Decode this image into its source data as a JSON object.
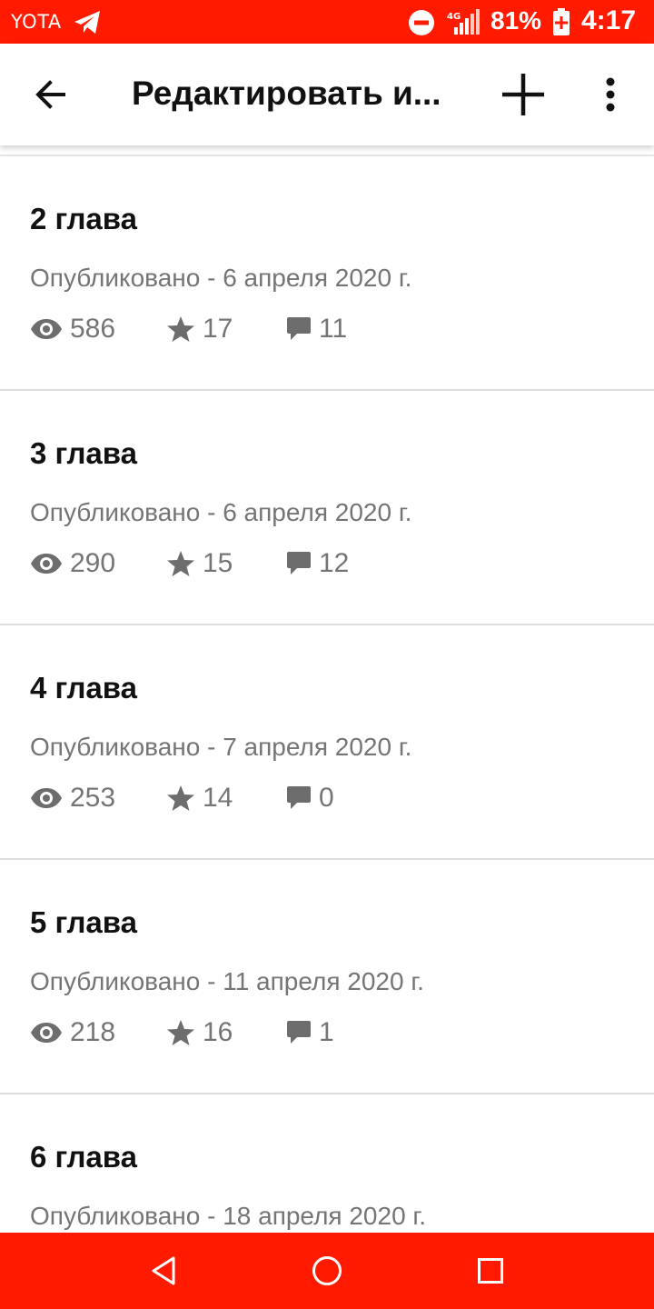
{
  "status_bar": {
    "carrier": "YOTA",
    "network": "4G",
    "battery": "81%",
    "time": "4:17",
    "icons": [
      "telegram-icon",
      "do-not-disturb-icon",
      "signal-icon",
      "battery-charging-icon"
    ]
  },
  "app_bar": {
    "title": "Редактировать и...",
    "icons": [
      "arrow-back-icon",
      "plus-icon",
      "more-vert-icon"
    ]
  },
  "chapters": [
    {
      "title": "2 глава",
      "published": "Опубликовано - 6 апреля 2020 г.",
      "views": "586",
      "votes": "17",
      "comments": "11"
    },
    {
      "title": "3 глава",
      "published": "Опубликовано - 6 апреля 2020 г.",
      "views": "290",
      "votes": "15",
      "comments": "12"
    },
    {
      "title": "4 глава",
      "published": "Опубликовано - 7 апреля 2020 г.",
      "views": "253",
      "votes": "14",
      "comments": "0"
    },
    {
      "title": "5 глава",
      "published": "Опубликовано - 11 апреля 2020 г.",
      "views": "218",
      "votes": "16",
      "comments": "1"
    },
    {
      "title": "6 глава",
      "published": "Опубликовано - 18 апреля 2020 г."
    }
  ],
  "nav_bar": {
    "icons": [
      "back-triangle-icon",
      "home-circle-icon",
      "recents-square-icon"
    ]
  },
  "colors": {
    "system_bars": "#ff1a00",
    "text_primary": "#111111",
    "text_secondary": "#757575",
    "divider": "#dedede"
  }
}
